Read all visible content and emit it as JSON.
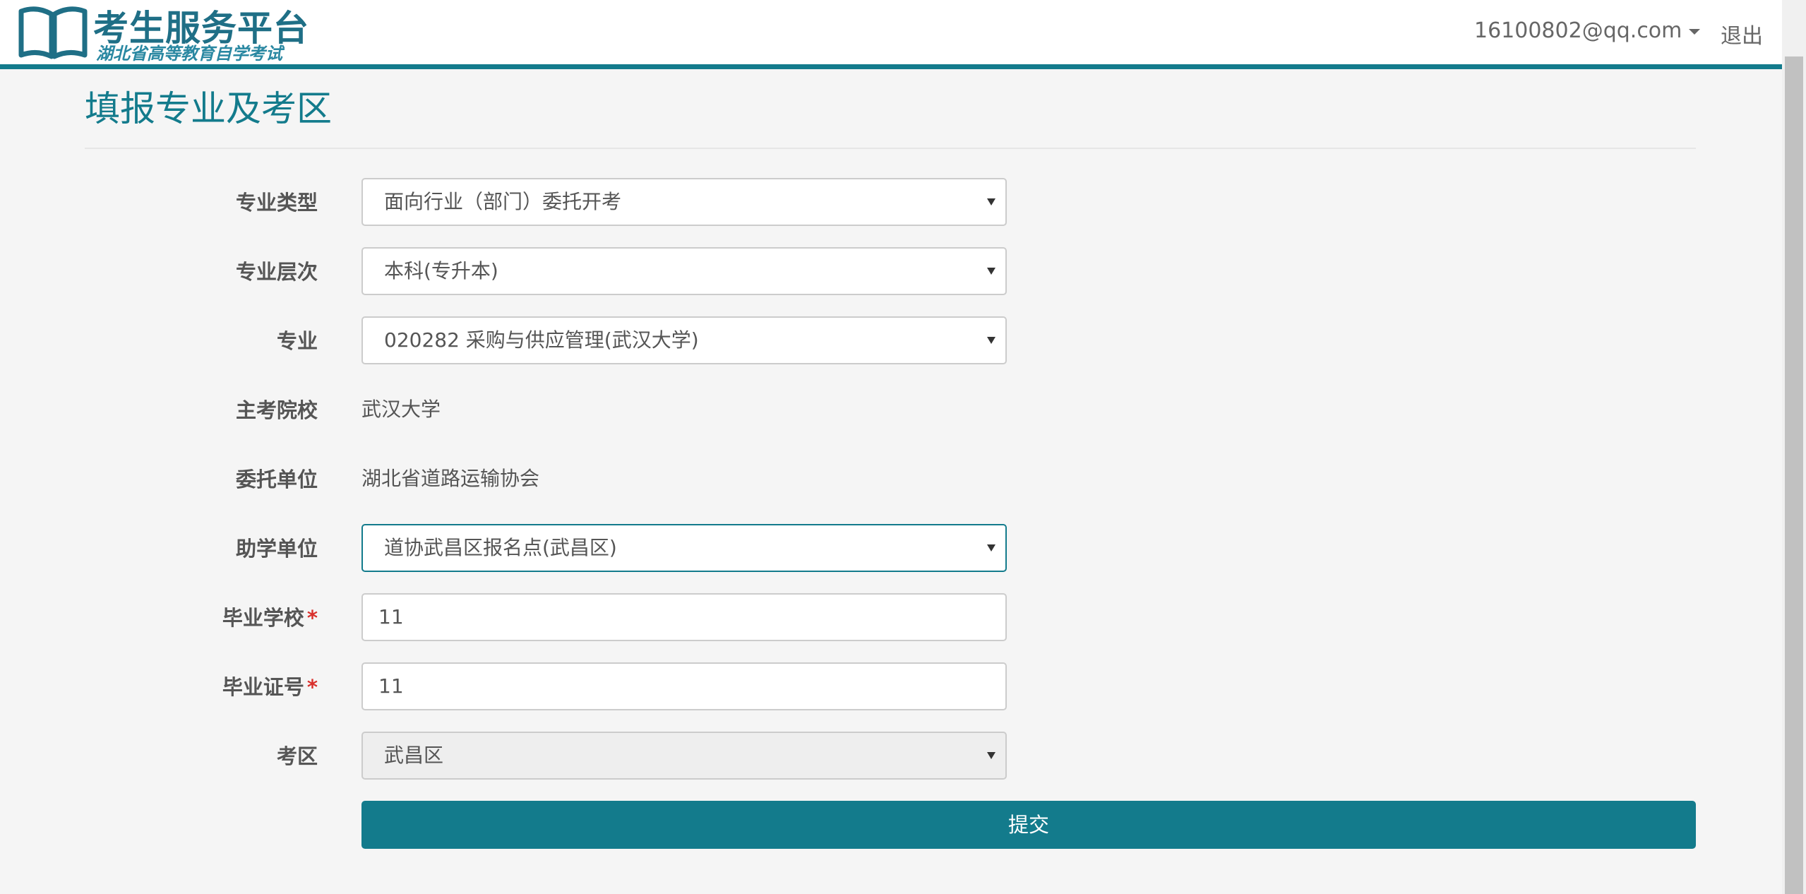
{
  "header": {
    "logo_title": "考生服务平台",
    "logo_subtitle": "湖北省高等教育自学考试",
    "user_email": "16100802@qq.com",
    "logout_label": "退出"
  },
  "page": {
    "title": "填报专业及考区"
  },
  "form": {
    "major_type": {
      "label": "专业类型",
      "value": "面向行业（部门）委托开考"
    },
    "major_level": {
      "label": "专业层次",
      "value": "本科(专升本)"
    },
    "major": {
      "label": "专业",
      "value": "020282 采购与供应管理(武汉大学)"
    },
    "host_school": {
      "label": "主考院校",
      "value": "武汉大学"
    },
    "entrusting_unit": {
      "label": "委托单位",
      "value": "湖北省道路运输协会"
    },
    "assisting_unit": {
      "label": "助学单位",
      "value": "道协武昌区报名点(武昌区)"
    },
    "graduate_school": {
      "label": "毕业学校",
      "required_mark": "*",
      "value": "11"
    },
    "diploma_number": {
      "label": "毕业证号",
      "required_mark": "*",
      "value": "11"
    },
    "exam_area": {
      "label": "考区",
      "value": "武昌区"
    },
    "submit_label": "提交"
  },
  "colors": {
    "accent": "#137b8c",
    "required": "#d9302c"
  }
}
